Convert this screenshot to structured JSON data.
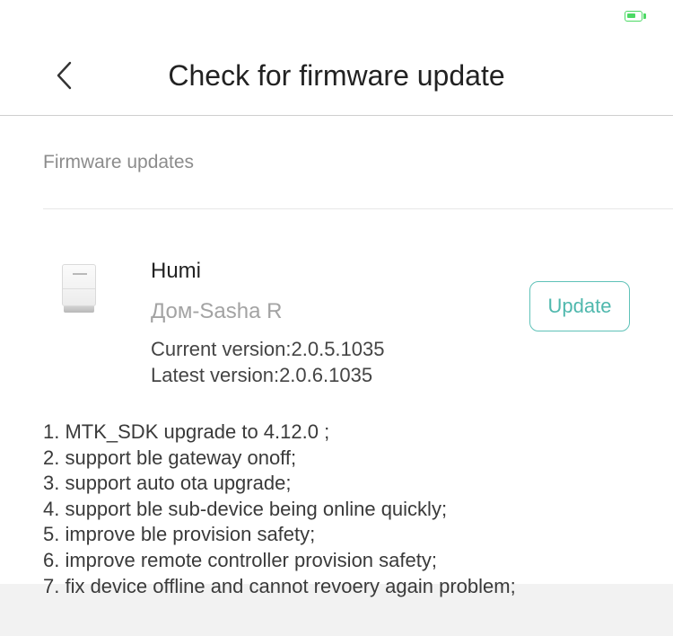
{
  "status_bar": {
    "battery_icon": "battery-charging-icon",
    "battery_color": "#4cd964"
  },
  "header": {
    "back_icon": "chevron-left-icon",
    "title": "Check for firmware update"
  },
  "section": {
    "title": "Firmware updates"
  },
  "device": {
    "image_icon": "humidifier-device-icon",
    "name": "Humi",
    "room": "Дом-Sasha R",
    "current_version": "Current version:2.0.5.1035",
    "latest_version": "Latest version:2.0.6.1035",
    "update_label": "Update"
  },
  "changelog": [
    "1. MTK_SDK upgrade to 4.12.0 ;",
    "2. support ble gateway onoff;",
    "3. support auto ota upgrade;",
    "4. support ble sub-device being online quickly;",
    "5. improve ble provision safety;",
    "6. improve remote controller provision safety;",
    "7. fix device offline and cannot revoery again problem;"
  ],
  "colors": {
    "accent": "#52bdb3",
    "text_primary": "#222222",
    "text_secondary": "#a3a3a3",
    "divider": "#cfcfcf",
    "bottom_bar": "#f2f2f2"
  }
}
